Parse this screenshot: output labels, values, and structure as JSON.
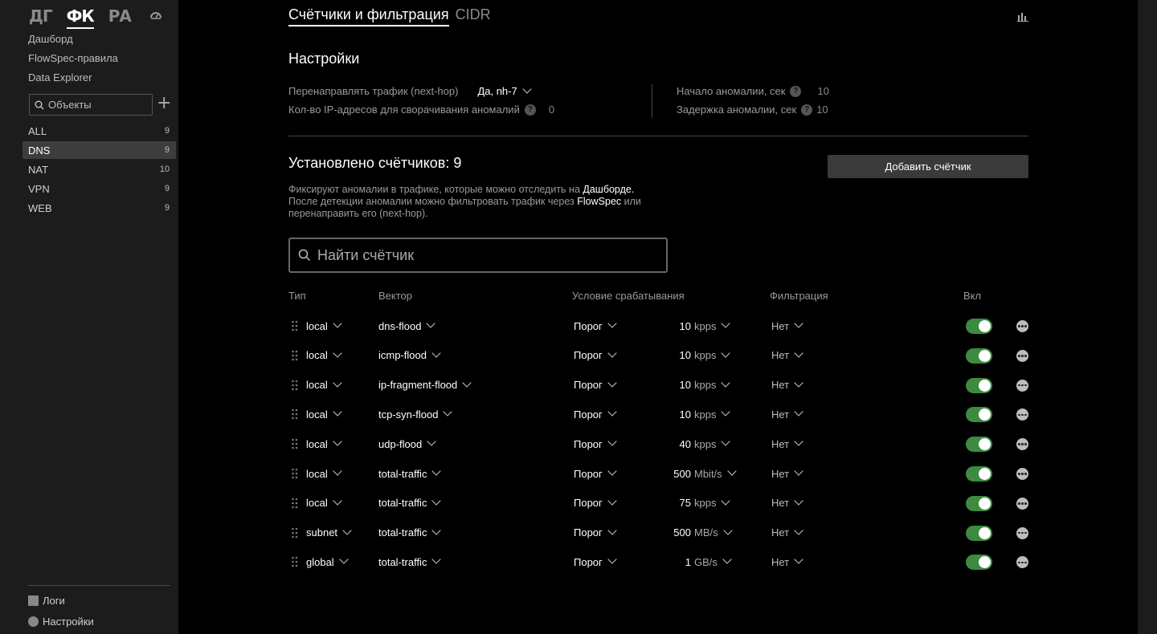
{
  "sidebar": {
    "logos": [
      "ДГ",
      "ФК",
      "РА"
    ],
    "nav": [
      "Дашборд",
      "FlowSpec-правила",
      "Data Explorer"
    ],
    "search_placeholder": "Объекты",
    "objects": [
      {
        "name": "ALL",
        "count": "9"
      },
      {
        "name": "DNS",
        "count": "9"
      },
      {
        "name": "NAT",
        "count": "10"
      },
      {
        "name": "VPN",
        "count": "9"
      },
      {
        "name": "WEB",
        "count": "9"
      }
    ],
    "bottom": [
      "Логи",
      "Настройки"
    ]
  },
  "tabs": [
    "Счётчики и фильтрация",
    "CIDR"
  ],
  "settings": {
    "title": "Настройки",
    "redirect_label": "Перенаправлять трафик (next-hop)",
    "redirect_value": "Да, nh-7",
    "collapse_label": "Кол-во IP-адресов для сворачивания аномалий",
    "collapse_value": "0",
    "start_label": "Начало аномалии, сек",
    "start_value": "10",
    "delay_label": "Задержка аномалии, сек",
    "delay_value": "10",
    "help": "?"
  },
  "counters": {
    "title": "Установлено счётчиков: 9",
    "add_button": "Добавить счётчик",
    "desc_1": "Фиксируют аномалии в трафике, которые можно отследить на ",
    "desc_link_1": "Дашборде.",
    "desc_2": "После детекции аномалии можно фильтровать трафик через ",
    "desc_link_2": "FlowSpec",
    "desc_3": " или перенаправить его (next-hop).",
    "search_placeholder": "Найти счётчик",
    "headers": {
      "type": "Тип",
      "vector": "Вектор",
      "condition": "Условие срабатывания",
      "filter": "Фильтрация",
      "enabled": "Вкл"
    },
    "rows": [
      {
        "type": "local",
        "vector": "dns-flood",
        "cond": "Порог",
        "value": "10",
        "unit": "kpps",
        "filter": "Нет"
      },
      {
        "type": "local",
        "vector": "icmp-flood",
        "cond": "Порог",
        "value": "10",
        "unit": "kpps",
        "filter": "Нет"
      },
      {
        "type": "local",
        "vector": "ip-fragment-flood",
        "cond": "Порог",
        "value": "10",
        "unit": "kpps",
        "filter": "Нет"
      },
      {
        "type": "local",
        "vector": "tcp-syn-flood",
        "cond": "Порог",
        "value": "10",
        "unit": "kpps",
        "filter": "Нет"
      },
      {
        "type": "local",
        "vector": "udp-flood",
        "cond": "Порог",
        "value": "40",
        "unit": "kpps",
        "filter": "Нет"
      },
      {
        "type": "local",
        "vector": "total-traffic",
        "cond": "Порог",
        "value": "500",
        "unit": "Mbit/s",
        "filter": "Нет"
      },
      {
        "type": "local",
        "vector": "total-traffic",
        "cond": "Порог",
        "value": "75",
        "unit": "kpps",
        "filter": "Нет"
      },
      {
        "type": "subnet",
        "vector": "total-traffic",
        "cond": "Порог",
        "value": "500",
        "unit": "MB/s",
        "filter": "Нет"
      },
      {
        "type": "global",
        "vector": "total-traffic",
        "cond": "Порог",
        "value": "1",
        "unit": "GB/s",
        "filter": "Нет"
      }
    ]
  },
  "colors": {
    "toggle_on": "#3d8b40",
    "sidebar_bg": "#1c1c1c",
    "bg": "#000000"
  }
}
